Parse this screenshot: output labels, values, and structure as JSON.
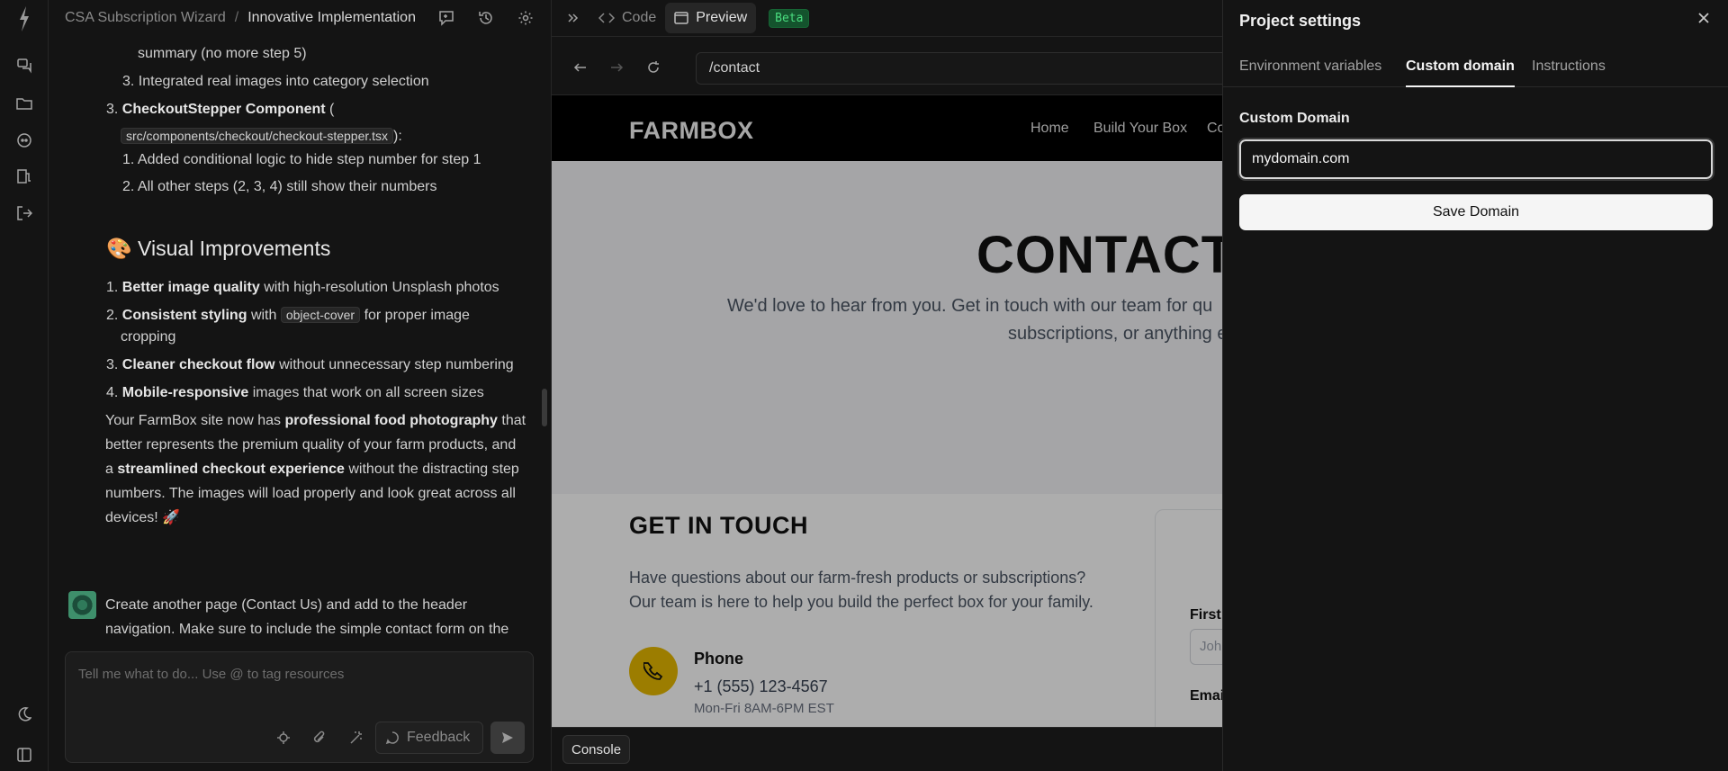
{
  "app": {
    "breadcrumb_project": "CSA Subscription Wizard",
    "breadcrumb_sep": "/",
    "breadcrumb_chat": "Innovative Implementation"
  },
  "chat": {
    "lines": {
      "l1": "summary (no more step 5)",
      "l2_num": "3.",
      "l2": "Integrated real images into category selection",
      "l3_num": "3.",
      "l3_bold": "CheckoutStepper Component",
      "l3_paren": "(",
      "l4_code": "src/components/checkout/checkout-stepper.tsx",
      "l4_end": "):",
      "l5_num": "1.",
      "l5": "Added conditional logic to hide step number for step 1",
      "l6_num": "2.",
      "l6": "All other steps (2, 3, 4) still show their numbers"
    },
    "heading": {
      "emoji": "🎨",
      "text": "Visual Improvements"
    },
    "items": [
      {
        "num": "1.",
        "bold": "Better image quality",
        "rest": "with high-resolution Unsplash photos"
      },
      {
        "num": "2.",
        "bold": "Consistent styling",
        "rest": "with",
        "code": "object-cover",
        "rest2": "for proper image",
        "rest3": "cropping"
      },
      {
        "num": "3.",
        "bold": "Cleaner checkout flow",
        "rest": "without unnecessary step numbering"
      },
      {
        "num": "4.",
        "bold": "Mobile-responsive",
        "rest": "images that work on all screen sizes"
      }
    ],
    "summary": {
      "p1a": "Your FarmBox site now has",
      "p1b": "professional food photography",
      "p1c": "that",
      "p2": "better represents the premium quality of your farm products, and",
      "p3a": "a",
      "p3b": "streamlined checkout experience",
      "p3c": "without the distracting step",
      "p4": "numbers. The images will load properly and look great across all",
      "p5": "devices! 🚀"
    },
    "user_message": {
      "m1": "Create another page (Contact Us) and add to the header",
      "m2": "navigation. Make sure to include the simple contact form on the"
    },
    "composer": {
      "placeholder": "Tell me what to do... Use @ to tag resources",
      "feedback_label": "Feedback"
    }
  },
  "preview": {
    "code_label": "Code",
    "preview_label": "Preview",
    "beta_label": "Beta",
    "url": "/contact",
    "console_label": "Console",
    "site": {
      "logo": "FARMBOX",
      "nav": [
        "Home",
        "Build Your Box",
        "Co"
      ],
      "hero_title": "CONTACT",
      "hero_sub1": "We'd love to hear from you. Get in touch with our team for qu",
      "hero_sub2": "subscriptions, or anything e",
      "git_title": "GET IN TOUCH",
      "git_p1": "Have questions about our farm-fresh products or subscriptions?",
      "git_p2": "Our team is here to help you build the perfect box for your family.",
      "phone_title": "Phone",
      "phone_number": "+1 (555) 123-4567",
      "phone_hours": "Mon-Fri 8AM-6PM EST",
      "form_first": "First",
      "form_first_ph": "Joh",
      "form_email": "Email"
    }
  },
  "drawer": {
    "title": "Project settings",
    "tabs": [
      "Environment variables",
      "Custom domain",
      "Instructions"
    ],
    "active_tab": "Custom domain",
    "label": "Custom Domain",
    "input_value": "mydomain.com",
    "save_label": "Save Domain"
  }
}
